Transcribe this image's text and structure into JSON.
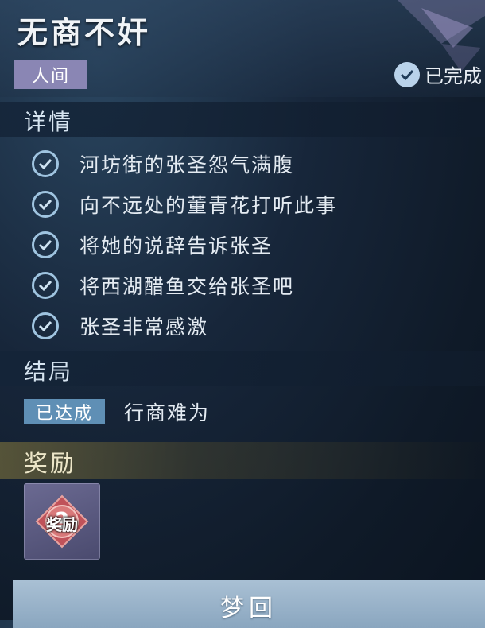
{
  "quest": {
    "title": "无商不奸",
    "realm_tag": "人间",
    "status_label": "已完成"
  },
  "details": {
    "section_title": "详情",
    "objectives": [
      {
        "text": "河坊街的张圣怨气满腹",
        "done": true
      },
      {
        "text": "向不远处的董青花打听此事",
        "done": true
      },
      {
        "text": "将她的说辞告诉张圣",
        "done": true
      },
      {
        "text": "将西湖醋鱼交给张圣吧",
        "done": true
      },
      {
        "text": "张圣非常感激",
        "done": true
      }
    ]
  },
  "ending": {
    "section_title": "结局",
    "status_tag": "已达成",
    "name": "行商难为"
  },
  "rewards": {
    "section_title": "奖励",
    "items": [
      {
        "label": "奖励",
        "icon": "mystery-reward-icon"
      }
    ]
  },
  "actions": {
    "dream_back_label": "梦回"
  },
  "colors": {
    "realm_tag_bg": "#8a86b4",
    "ending_tag_bg": "#5f8fb5",
    "check_color": "#9fc4e0",
    "button_bg": "#9bb4ca"
  }
}
